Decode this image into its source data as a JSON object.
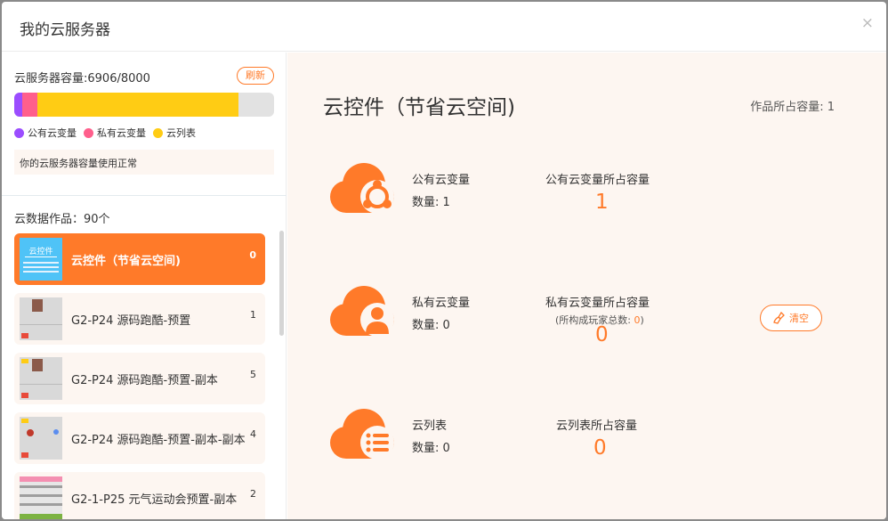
{
  "dialog": {
    "title": "我的云服务器",
    "close_glyph": "×"
  },
  "sidebar": {
    "capacity_label": "云服务器容量:6906/8000",
    "refresh_label": "刷新",
    "capacity_used": 6906,
    "capacity_total": 8000,
    "segments": [
      {
        "name": "公有云变量",
        "fraction": 0.031,
        "color": "#9b4dff"
      },
      {
        "name": "私有云变量",
        "fraction": 0.058,
        "color": "#ff5f8c"
      },
      {
        "name": "云列表",
        "fraction": 0.773,
        "color": "#ffcc14"
      }
    ],
    "status_text": "你的云服务器容量使用正常",
    "works_label": "云数据作品：90个",
    "works": [
      {
        "name": "云控件（节省云空间)",
        "count": "0",
        "active": true
      },
      {
        "name": "G2-P24 源码跑酷-预置",
        "count": "1",
        "active": false
      },
      {
        "name": "G2-P24 源码跑酷-预置-副本",
        "count": "5",
        "active": false
      },
      {
        "name": "G2-P24 源码跑酷-预置-副本-副本",
        "count": "4",
        "active": false
      },
      {
        "name": "G2-1-P25 元气运动会预置-副本",
        "count": "2",
        "active": false
      }
    ],
    "thumb_text": "云控件"
  },
  "main": {
    "title": "云控件（节省云空间)",
    "occupy_label": "作品所占容量: 1",
    "rows": [
      {
        "name": "公有云变量",
        "qty": "数量: 1",
        "cap_label": "公有云变量所占容量",
        "cap_value": "1",
        "icon": "network-icon"
      },
      {
        "name": "私有云变量",
        "qty": "数量: 0",
        "cap_label": "私有云变量所占容量",
        "cap_sub_prefix": "(所构成玩家总数: ",
        "cap_sub_value": "0",
        "cap_sub_suffix": ")",
        "cap_value": "0",
        "icon": "user-icon",
        "clear_label": "清空"
      },
      {
        "name": "云列表",
        "qty": "数量: 0",
        "cap_label": "云列表所占容量",
        "cap_value": "0",
        "icon": "list-icon"
      }
    ]
  },
  "colors": {
    "accent": "#ff7a29",
    "panel_bg": "#fdf6f1"
  }
}
